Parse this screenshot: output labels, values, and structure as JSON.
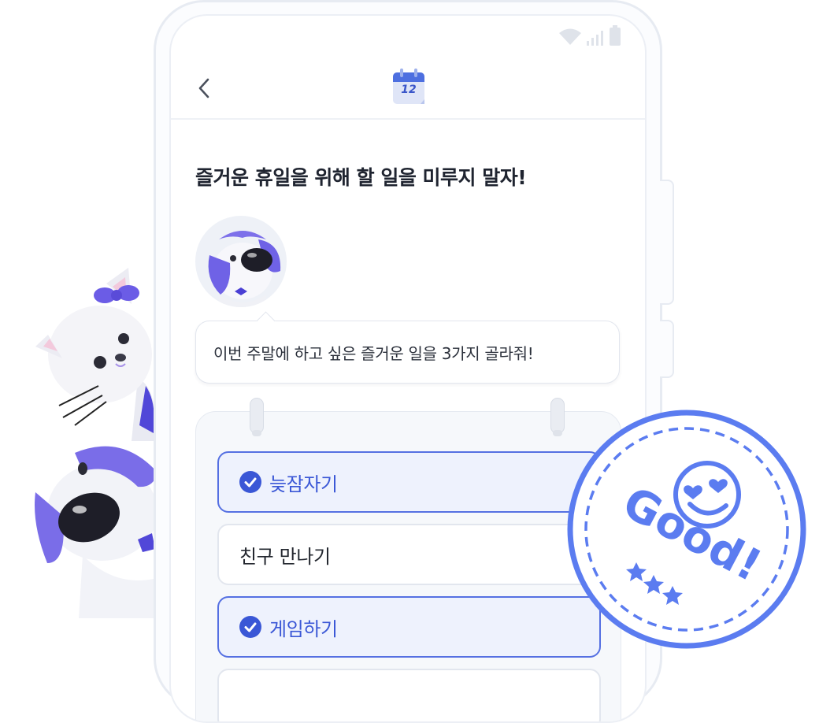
{
  "header": {
    "calendar_day": "12"
  },
  "title": "즐거운 휴일을 위해 할 일을 미루지 말자!",
  "prompt_bubble": "이번 주말에 하고 싶은 즐거운 일을 3가지 골라줘!",
  "options": [
    {
      "label": "늦잠자기",
      "selected": true
    },
    {
      "label": "친구 만나기",
      "selected": false
    },
    {
      "label": "게임하기",
      "selected": true
    },
    {
      "label": "",
      "selected": false
    }
  ],
  "stamp": {
    "text": "Good!",
    "color": "#5b7cf0"
  },
  "colors": {
    "accent": "#3a57d6",
    "selected_bg": "#eef2fd",
    "mascot_purple": "#6b5ce6"
  },
  "icons": [
    "back-chevron-icon",
    "calendar-icon",
    "wifi-icon",
    "signal-icon",
    "battery-icon",
    "check-circle-icon",
    "smiley-heart-eyes-icon",
    "star-icon"
  ]
}
